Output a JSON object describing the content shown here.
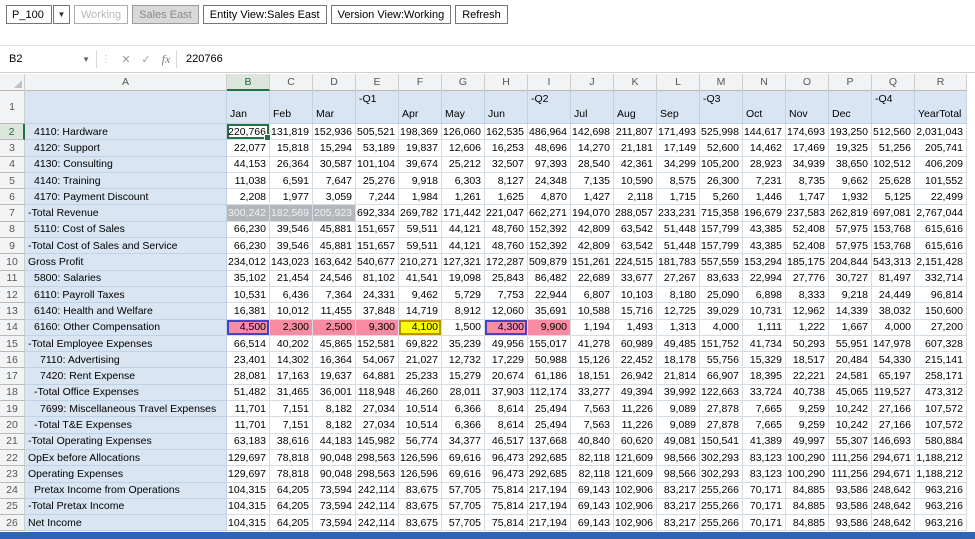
{
  "pov_toolbar": {
    "page_dropdown": {
      "value": "P_100"
    },
    "buttons": {
      "working": "Working",
      "sales_east": "Sales East",
      "entity_view": "Entity View:Sales East",
      "version_view": "Version View:Working",
      "refresh": "Refresh"
    }
  },
  "formula_bar": {
    "name_box": "B2",
    "cancel": "✕",
    "enter": "✓",
    "insert_function": "fx",
    "value": "220766"
  },
  "colors": {
    "member_bg": "#D9E5F3",
    "data_bg": "#FFFFFF",
    "selection_green": "#217346",
    "highlight_pink": "#F78CA2",
    "highlight_yellow": "#FFFF00",
    "highlight_gray": "#B3B7BC",
    "purple_border": "#4444C0",
    "olive_border": "#BF9000",
    "bottom_bar_blue": "#2E64B5"
  },
  "grid": {
    "column_letters": [
      "A",
      "B",
      "C",
      "D",
      "E",
      "F",
      "G",
      "H",
      "I",
      "J",
      "K",
      "L",
      "M",
      "N",
      "O",
      "P",
      "Q",
      "R"
    ],
    "selection": {
      "cell": "B2",
      "column": "B",
      "row": 2
    },
    "header_row": {
      "cells": [
        {
          "text": "Jan",
          "type": "month"
        },
        {
          "text": "Feb",
          "type": "month"
        },
        {
          "text": "Mar",
          "type": "month"
        },
        {
          "text": "-Q1",
          "type": "quarter"
        },
        {
          "text": "Apr",
          "type": "month"
        },
        {
          "text": "May",
          "type": "month"
        },
        {
          "text": "Jun",
          "type": "month"
        },
        {
          "text": "-Q2",
          "type": "quarter"
        },
        {
          "text": "Jul",
          "type": "month"
        },
        {
          "text": "Aug",
          "type": "month"
        },
        {
          "text": "Sep",
          "type": "month"
        },
        {
          "text": "-Q3",
          "type": "quarter"
        },
        {
          "text": "Oct",
          "type": "month"
        },
        {
          "text": "Nov",
          "type": "month"
        },
        {
          "text": "Dec",
          "type": "month"
        },
        {
          "text": "-Q4",
          "type": "quarter"
        },
        {
          "text": "YearTotal",
          "type": "year"
        }
      ]
    },
    "rows": [
      {
        "label": "4110: Hardware",
        "indent": 1,
        "values": [
          "220,766",
          "131,819",
          "152,936",
          "505,521",
          "198,369",
          "126,060",
          "162,535",
          "486,964",
          "142,698",
          "211,807",
          "171,493",
          "525,998",
          "144,617",
          "174,693",
          "193,250",
          "512,560",
          "2,031,043"
        ]
      },
      {
        "label": "4120: Support",
        "indent": 1,
        "values": [
          "22,077",
          "15,818",
          "15,294",
          "53,189",
          "19,837",
          "12,606",
          "16,253",
          "48,696",
          "14,270",
          "21,181",
          "17,149",
          "52,600",
          "14,462",
          "17,469",
          "19,325",
          "51,256",
          "205,741"
        ]
      },
      {
        "label": "4130: Consulting",
        "indent": 1,
        "values": [
          "44,153",
          "26,364",
          "30,587",
          "101,104",
          "39,674",
          "25,212",
          "32,507",
          "97,393",
          "28,540",
          "42,361",
          "34,299",
          "105,200",
          "28,923",
          "34,939",
          "38,650",
          "102,512",
          "406,209"
        ]
      },
      {
        "label": "4140: Training",
        "indent": 1,
        "values": [
          "11,038",
          "6,591",
          "7,647",
          "25,276",
          "9,918",
          "6,303",
          "8,127",
          "24,348",
          "7,135",
          "10,590",
          "8,575",
          "26,300",
          "7,231",
          "8,735",
          "9,662",
          "25,628",
          "101,552"
        ]
      },
      {
        "label": "4170: Payment Discount",
        "indent": 1,
        "values": [
          "2,208",
          "1,977",
          "3,059",
          "7,244",
          "1,984",
          "1,261",
          "1,625",
          "4,870",
          "1,427",
          "2,118",
          "1,715",
          "5,260",
          "1,446",
          "1,747",
          "1,932",
          "5,125",
          "22,499"
        ]
      },
      {
        "label": "-Total Revenue",
        "indent": 0,
        "styles": {
          "0": "hl-gray",
          "1": "hl-gray",
          "2": "hl-gray"
        },
        "values": [
          "300,242",
          "182,569",
          "205,923",
          "692,334",
          "269,782",
          "171,442",
          "221,047",
          "662,271",
          "194,070",
          "288,057",
          "233,231",
          "715,358",
          "196,679",
          "237,583",
          "262,819",
          "697,081",
          "2,767,044"
        ]
      },
      {
        "label": "5110: Cost of Sales",
        "indent": 1,
        "values": [
          "66,230",
          "39,546",
          "45,881",
          "151,657",
          "59,511",
          "44,121",
          "48,760",
          "152,392",
          "42,809",
          "63,542",
          "51,448",
          "157,799",
          "43,385",
          "52,408",
          "57,975",
          "153,768",
          "615,616"
        ]
      },
      {
        "label": "-Total Cost of Sales and Service",
        "indent": 0,
        "values": [
          "66,230",
          "39,546",
          "45,881",
          "151,657",
          "59,511",
          "44,121",
          "48,760",
          "152,392",
          "42,809",
          "63,542",
          "51,448",
          "157,799",
          "43,385",
          "52,408",
          "57,975",
          "153,768",
          "615,616"
        ]
      },
      {
        "label": "Gross Profit",
        "indent": 0,
        "values": [
          "234,012",
          "143,023",
          "163,642",
          "540,677",
          "210,271",
          "127,321",
          "172,287",
          "509,879",
          "151,261",
          "224,515",
          "181,783",
          "557,559",
          "153,294",
          "185,175",
          "204,844",
          "543,313",
          "2,151,428"
        ]
      },
      {
        "label": "5800: Salaries",
        "indent": 1,
        "values": [
          "35,102",
          "21,454",
          "24,546",
          "81,102",
          "41,541",
          "19,098",
          "25,843",
          "86,482",
          "22,689",
          "33,677",
          "27,267",
          "83,633",
          "22,994",
          "27,776",
          "30,727",
          "81,497",
          "332,714"
        ]
      },
      {
        "label": "6110: Payroll Taxes",
        "indent": 1,
        "values": [
          "10,531",
          "6,436",
          "7,364",
          "24,331",
          "9,462",
          "5,729",
          "7,753",
          "22,944",
          "6,807",
          "10,103",
          "8,180",
          "25,090",
          "6,898",
          "8,333",
          "9,218",
          "24,449",
          "96,814"
        ]
      },
      {
        "label": "6140: Health and Welfare",
        "indent": 1,
        "values": [
          "16,381",
          "10,012",
          "11,455",
          "37,848",
          "14,719",
          "8,912",
          "12,060",
          "35,691",
          "10,588",
          "15,716",
          "12,725",
          "39,029",
          "10,731",
          "12,962",
          "14,339",
          "38,032",
          "150,600"
        ]
      },
      {
        "label": "6160: Other Compensation",
        "indent": 1,
        "styles": {
          "0": "hl-pink bd-purple",
          "1": "hl-pink",
          "2": "hl-pink",
          "3": "hl-pink",
          "4": "hl-yellow bd-olive",
          "6": "hl-pink bd-purple",
          "7": "hl-pink"
        },
        "values": [
          "4,500",
          "2,300",
          "2,500",
          "9,300",
          "4,100",
          "1,500",
          "4,300",
          "9,900",
          "1,194",
          "1,493",
          "1,313",
          "4,000",
          "1,111",
          "1,222",
          "1,667",
          "4,000",
          "27,200"
        ]
      },
      {
        "label": "-Total Employee Expenses",
        "indent": 0,
        "values": [
          "66,514",
          "40,202",
          "45,865",
          "152,581",
          "69,822",
          "35,239",
          "49,956",
          "155,017",
          "41,278",
          "60,989",
          "49,485",
          "151,752",
          "41,734",
          "50,293",
          "55,951",
          "147,978",
          "607,328"
        ]
      },
      {
        "label": "7110: Advertising",
        "indent": 2,
        "values": [
          "23,401",
          "14,302",
          "16,364",
          "54,067",
          "21,027",
          "12,732",
          "17,229",
          "50,988",
          "15,126",
          "22,452",
          "18,178",
          "55,756",
          "15,329",
          "18,517",
          "20,484",
          "54,330",
          "215,141"
        ]
      },
      {
        "label": "7420: Rent Expense",
        "indent": 2,
        "values": [
          "28,081",
          "17,163",
          "19,637",
          "64,881",
          "25,233",
          "15,279",
          "20,674",
          "61,186",
          "18,151",
          "26,942",
          "21,814",
          "66,907",
          "18,395",
          "22,221",
          "24,581",
          "65,197",
          "258,171"
        ]
      },
      {
        "label": "-Total Office Expenses",
        "indent": 1,
        "values": [
          "51,482",
          "31,465",
          "36,001",
          "118,948",
          "46,260",
          "28,011",
          "37,903",
          "112,174",
          "33,277",
          "49,394",
          "39,992",
          "122,663",
          "33,724",
          "40,738",
          "45,065",
          "119,527",
          "473,312"
        ]
      },
      {
        "label": "7699: Miscellaneous Travel Expenses",
        "indent": 2,
        "values": [
          "11,701",
          "7,151",
          "8,182",
          "27,034",
          "10,514",
          "6,366",
          "8,614",
          "25,494",
          "7,563",
          "11,226",
          "9,089",
          "27,878",
          "7,665",
          "9,259",
          "10,242",
          "27,166",
          "107,572"
        ]
      },
      {
        "label": "-Total T&E Expenses",
        "indent": 1,
        "values": [
          "11,701",
          "7,151",
          "8,182",
          "27,034",
          "10,514",
          "6,366",
          "8,614",
          "25,494",
          "7,563",
          "11,226",
          "9,089",
          "27,878",
          "7,665",
          "9,259",
          "10,242",
          "27,166",
          "107,572"
        ]
      },
      {
        "label": "-Total Operating Expenses",
        "indent": 0,
        "values": [
          "63,183",
          "38,616",
          "44,183",
          "145,982",
          "56,774",
          "34,377",
          "46,517",
          "137,668",
          "40,840",
          "60,620",
          "49,081",
          "150,541",
          "41,389",
          "49,997",
          "55,307",
          "146,693",
          "580,884"
        ]
      },
      {
        "label": "OpEx before Allocations",
        "indent": 0,
        "values": [
          "129,697",
          "78,818",
          "90,048",
          "298,563",
          "126,596",
          "69,616",
          "96,473",
          "292,685",
          "82,118",
          "121,609",
          "98,566",
          "302,293",
          "83,123",
          "100,290",
          "111,256",
          "294,671",
          "1,188,212"
        ]
      },
      {
        "label": "Operating Expenses",
        "indent": 0,
        "values": [
          "129,697",
          "78,818",
          "90,048",
          "298,563",
          "126,596",
          "69,616",
          "96,473",
          "292,685",
          "82,118",
          "121,609",
          "98,566",
          "302,293",
          "83,123",
          "100,290",
          "111,256",
          "294,671",
          "1,188,212"
        ]
      },
      {
        "label": "Pretax Income from Operations",
        "indent": 1,
        "values": [
          "104,315",
          "64,205",
          "73,594",
          "242,114",
          "83,675",
          "57,705",
          "75,814",
          "217,194",
          "69,143",
          "102,906",
          "83,217",
          "255,266",
          "70,171",
          "84,885",
          "93,586",
          "248,642",
          "963,216"
        ]
      },
      {
        "label": "-Total Pretax Income",
        "indent": 0,
        "values": [
          "104,315",
          "64,205",
          "73,594",
          "242,114",
          "83,675",
          "57,705",
          "75,814",
          "217,194",
          "69,143",
          "102,906",
          "83,217",
          "255,266",
          "70,171",
          "84,885",
          "93,586",
          "248,642",
          "963,216"
        ]
      },
      {
        "label": "Net Income",
        "indent": 0,
        "values": [
          "104,315",
          "64,205",
          "73,594",
          "242,114",
          "83,675",
          "57,705",
          "75,814",
          "217,194",
          "69,143",
          "102,906",
          "83,217",
          "255,266",
          "70,171",
          "84,885",
          "93,586",
          "248,642",
          "963,216"
        ]
      }
    ]
  }
}
